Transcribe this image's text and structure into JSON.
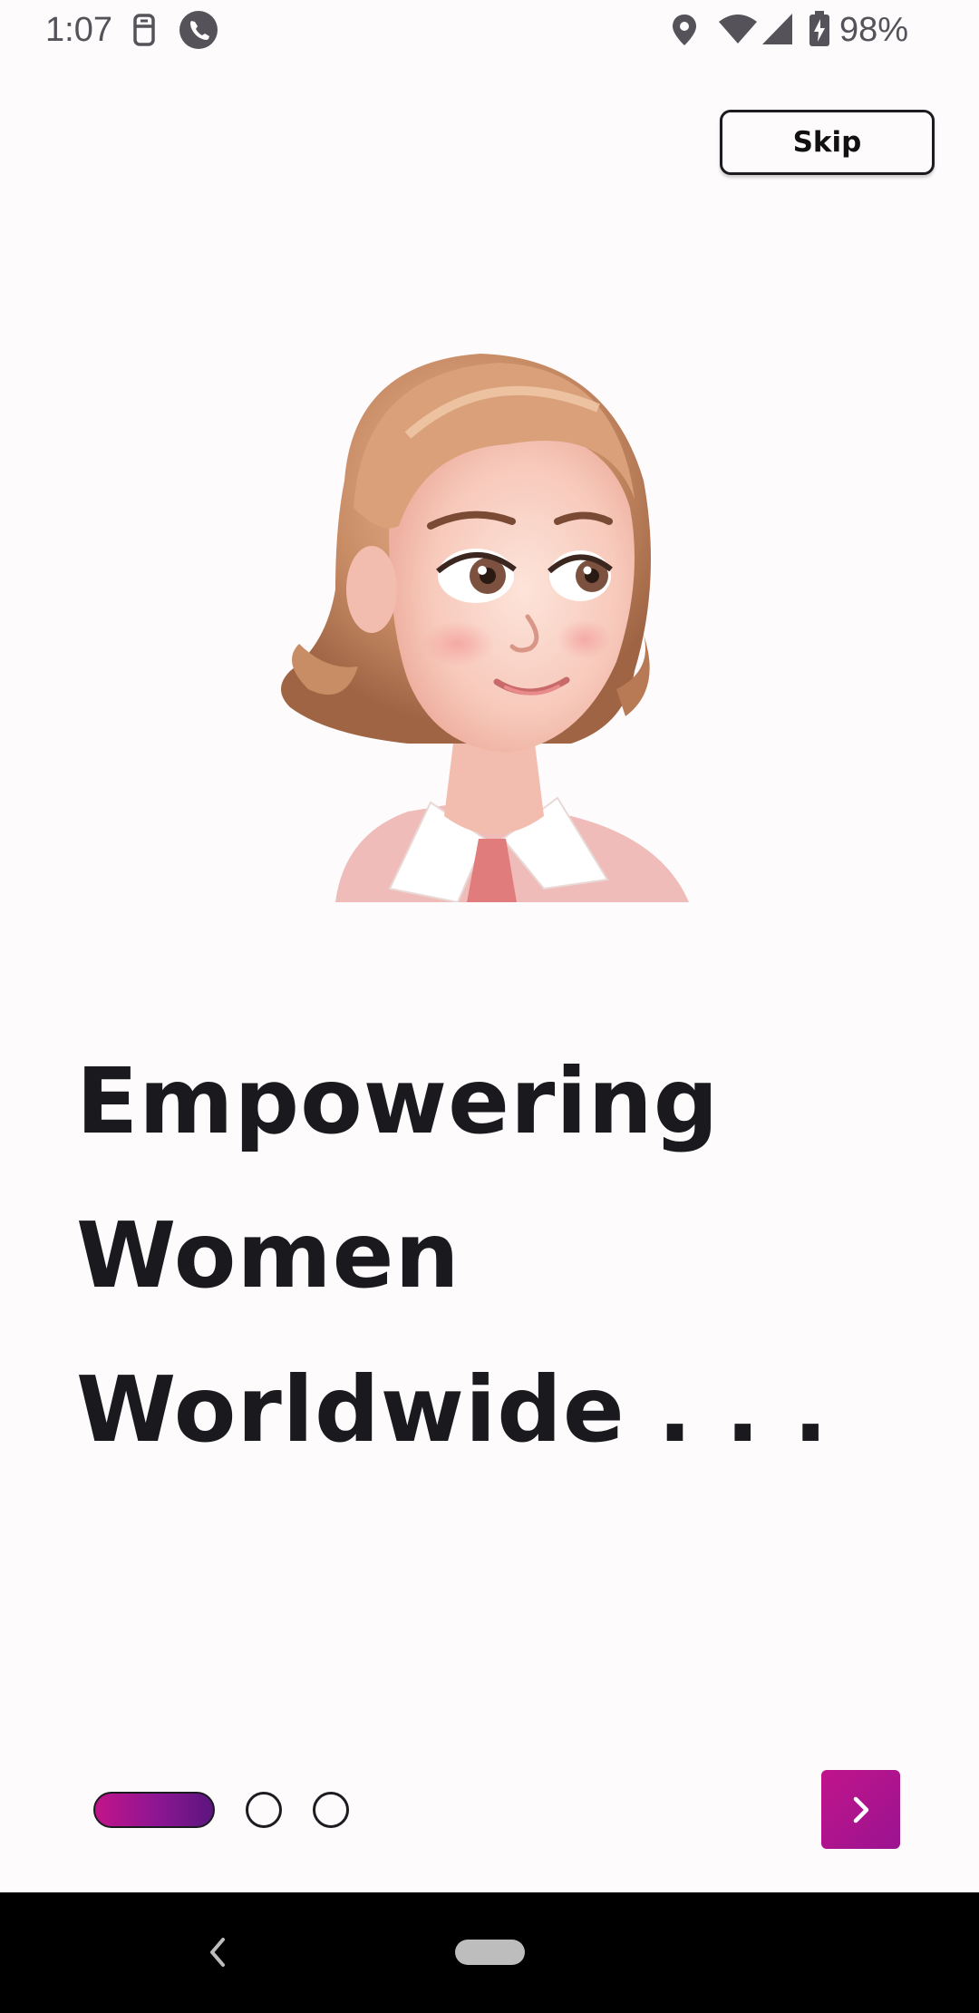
{
  "status_bar": {
    "time": "1:07",
    "battery": "98%",
    "icons": [
      "sim-icon",
      "phone-call-icon",
      "location-icon",
      "wifi-icon",
      "signal-icon",
      "battery-charging-icon"
    ]
  },
  "header": {
    "skip_label": "Skip"
  },
  "illustration": {
    "icon": "woman-avatar-illustration"
  },
  "headline": {
    "line1": "Empowering",
    "line2": "Women",
    "line3": "Worldwide . . ."
  },
  "pagination": {
    "total_pages": 3,
    "current_page": 1
  },
  "next_button": {
    "icon": "chevron-right-icon"
  },
  "colors": {
    "accent": "#b5148c",
    "accent_dark": "#5c157e",
    "background": "#fefbfd",
    "text": "#1c1b20"
  }
}
